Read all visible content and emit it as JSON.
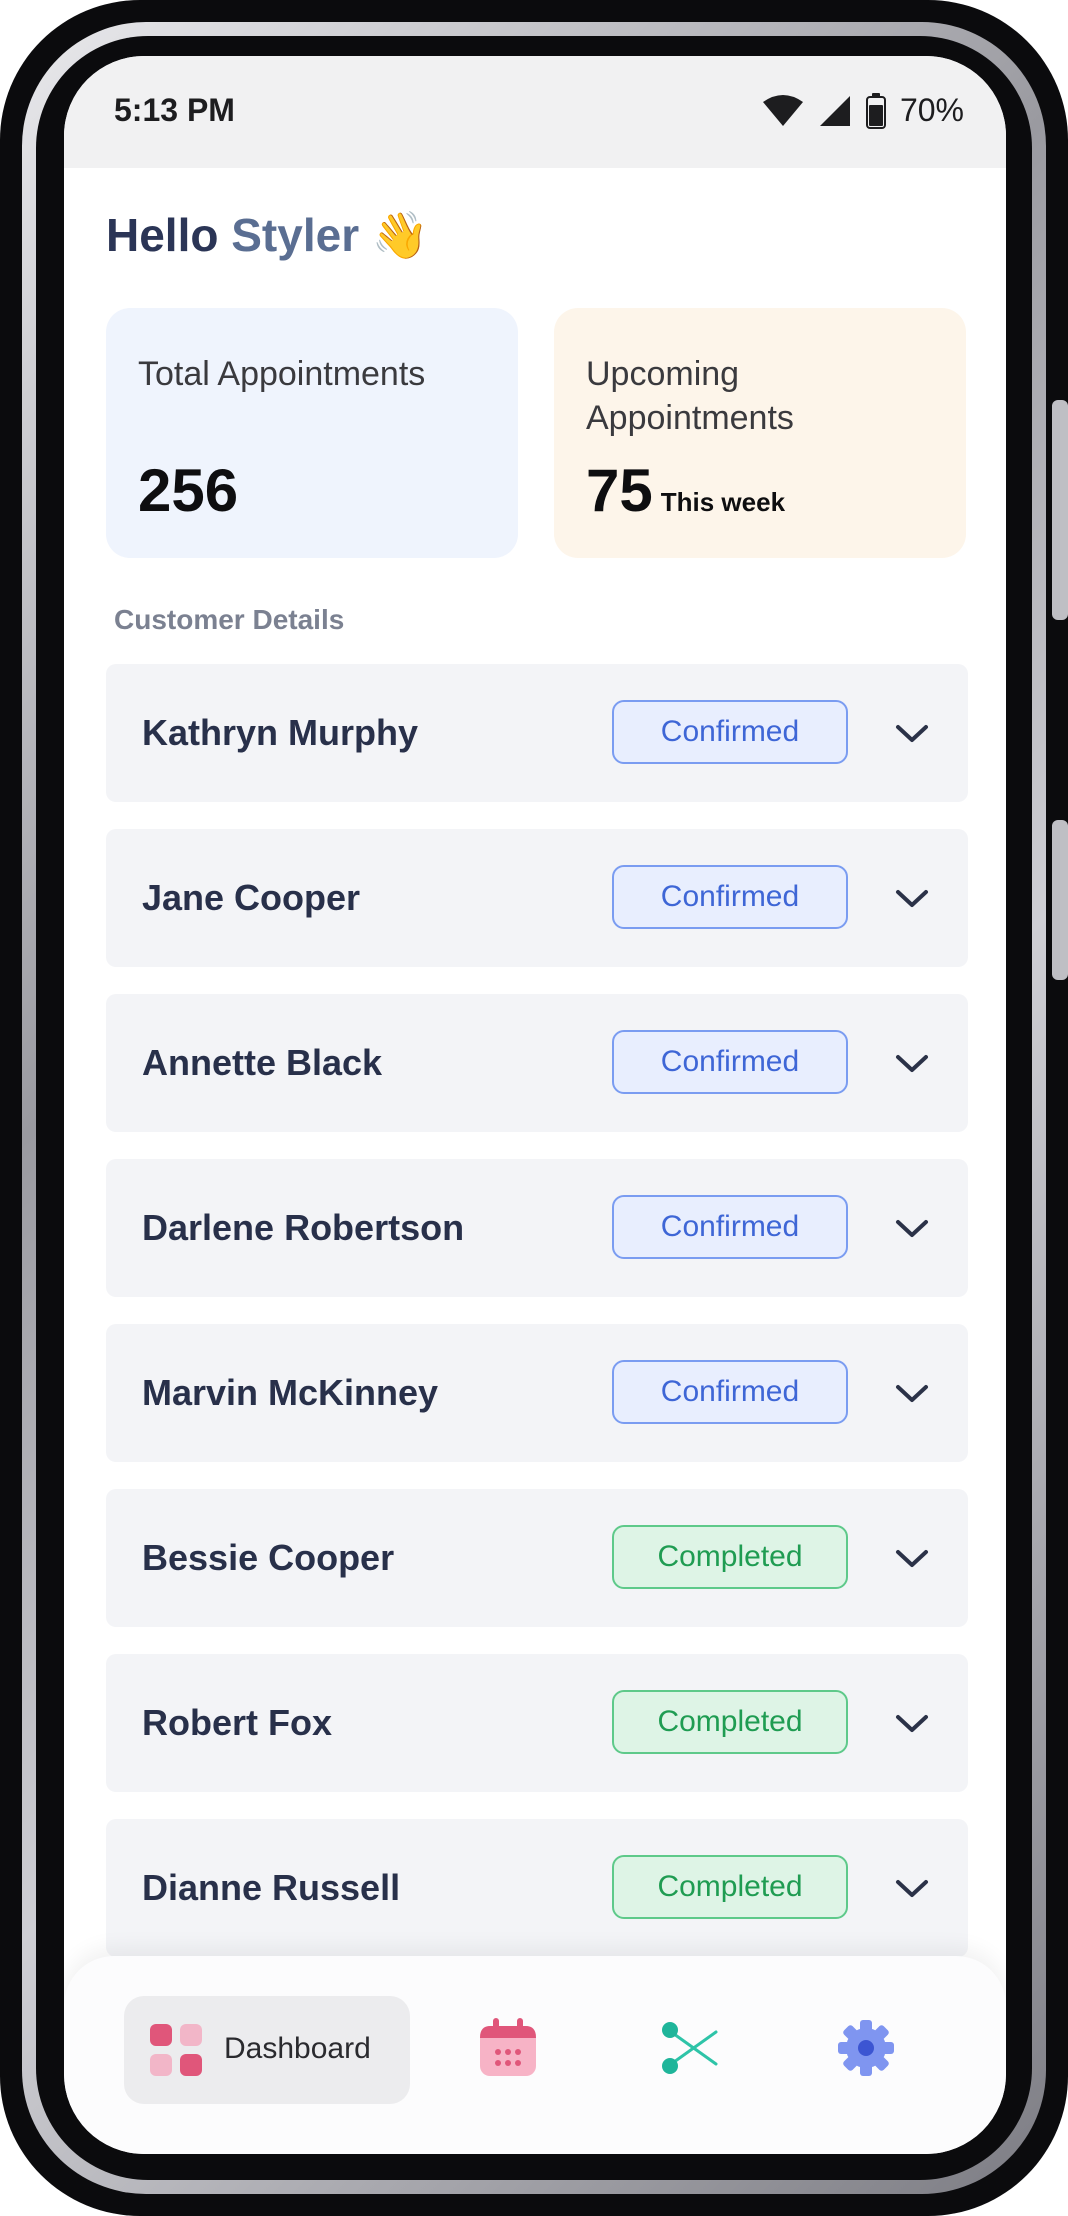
{
  "status_bar": {
    "time": "5:13 PM",
    "battery": "70%"
  },
  "greeting": {
    "hello": "Hello",
    "name": "Styler",
    "emoji": "👋"
  },
  "stats": {
    "total": {
      "label": "Total Appointments",
      "value": "256"
    },
    "upcoming": {
      "label": "Upcoming Appointments",
      "value": "75",
      "sub": "This week"
    }
  },
  "section_title": "Customer Details",
  "customers": [
    {
      "name": "Kathryn Murphy",
      "status": "Confirmed"
    },
    {
      "name": "Jane Cooper",
      "status": "Confirmed"
    },
    {
      "name": "Annette Black",
      "status": "Confirmed"
    },
    {
      "name": "Darlene Robertson",
      "status": "Confirmed"
    },
    {
      "name": "Marvin McKinney",
      "status": "Confirmed"
    },
    {
      "name": "Bessie Cooper",
      "status": "Completed"
    },
    {
      "name": "Robert Fox",
      "status": "Completed"
    },
    {
      "name": "Dianne Russell",
      "status": "Completed"
    }
  ],
  "nav": {
    "dashboard_label": "Dashboard",
    "items": [
      "dashboard-icon",
      "calendar-icon",
      "scissors-icon",
      "gear-icon"
    ]
  },
  "colors": {
    "confirmed": "#3e66d6",
    "completed": "#1f9c52",
    "total_card": "#eff4fd",
    "upcoming_card": "#fdf5ea"
  }
}
